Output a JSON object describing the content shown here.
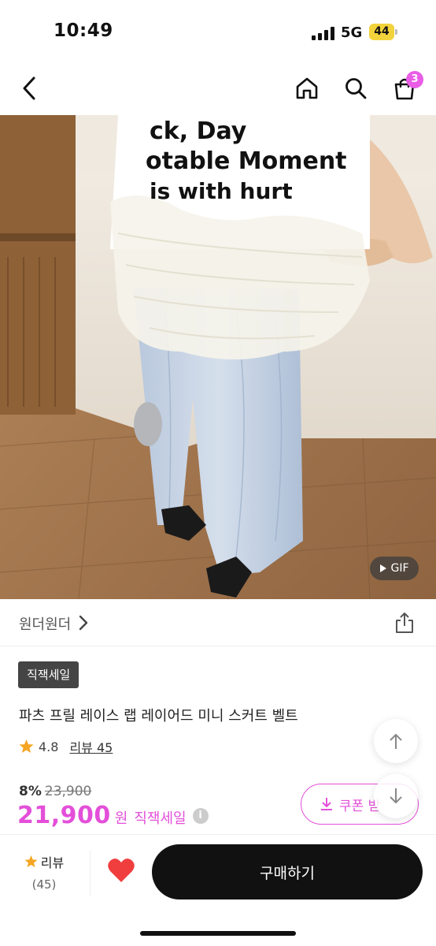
{
  "status_bar": {
    "time": "10:49",
    "network": "5G",
    "battery": "44"
  },
  "nav": {
    "cart_count": "3",
    "icons": [
      "back-arrow-icon",
      "home-icon",
      "search-icon",
      "shopping-bag-icon"
    ]
  },
  "hero": {
    "shirt_text": [
      "ck, Day",
      "otable Moment",
      "is with hurt"
    ],
    "gif_label": "GIF"
  },
  "brand": {
    "name": "원더원더"
  },
  "product": {
    "tag": "직잭세일",
    "title": "파츠 프릴 레이스 랩 레이어드 미니 스커트 벨트",
    "rating": "4.8",
    "review_label": "리뷰 45",
    "discount": "8%",
    "original_price": "23,900",
    "price": "21,900",
    "price_unit": "원",
    "price_note": "직잭세일",
    "info_icon": "i"
  },
  "coupon": {
    "label": "쿠폰 받"
  },
  "bottom_bar": {
    "review_label": "리뷰",
    "review_count": "(45)",
    "buy_label": "구매하기"
  },
  "colors": {
    "accent": "#e34fd9",
    "star": "#f5a623",
    "heart": "#f03e3e",
    "buy_button": "#111111"
  }
}
